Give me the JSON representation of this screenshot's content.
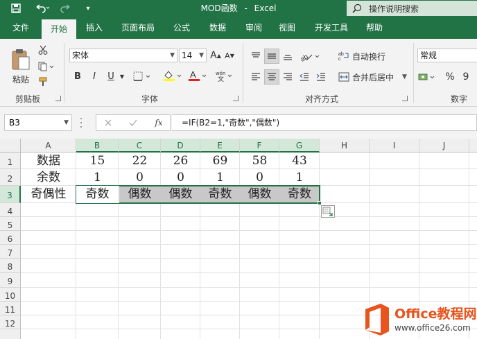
{
  "titlebar": {
    "doc_name": "MOD函数",
    "separator": "-",
    "app_name": "Excel",
    "tell_me": "操作说明搜索"
  },
  "tabs": [
    "文件",
    "开始",
    "插入",
    "页面布局",
    "公式",
    "数据",
    "审阅",
    "视图",
    "开发工具",
    "帮助"
  ],
  "ribbon": {
    "clipboard": {
      "paste": "粘贴",
      "label": "剪贴板"
    },
    "font": {
      "name": "宋体",
      "size": "14",
      "bold": "B",
      "italic": "I",
      "underline": "U",
      "label": "字体",
      "grow": "A",
      "shrink": "A"
    },
    "alignment": {
      "wrap": "自动换行",
      "merge": "合并后居中",
      "label": "对齐方式"
    },
    "number": {
      "format": "常规",
      "percent": "%",
      "comma": "9",
      "label": "数字"
    }
  },
  "formula_bar": {
    "name_box": "B3",
    "fx": "fx",
    "formula": "=IF(B2=1,\"奇数\",\"偶数\")"
  },
  "sheet": {
    "columns": [
      "A",
      "B",
      "C",
      "D",
      "E",
      "F",
      "G",
      "H",
      "I",
      "J"
    ],
    "rows": [
      "1",
      "2",
      "3",
      "4",
      "5",
      "6",
      "7",
      "8",
      "9",
      "10",
      "11",
      "12"
    ],
    "cells": [
      [
        "数据",
        "15",
        "22",
        "26",
        "69",
        "58",
        "43"
      ],
      [
        "余数",
        "1",
        "0",
        "0",
        "1",
        "0",
        "1"
      ],
      [
        "奇偶性",
        "奇数",
        "偶数",
        "偶数",
        "奇数",
        "偶数",
        "奇数"
      ]
    ]
  },
  "watermark": {
    "brand": "Office教程网",
    "url": "www.office26.com"
  },
  "colors": {
    "excel_green": "#217346",
    "ribbon_bg": "#f3f3f3",
    "selected_fill": "#c8c8c8",
    "logo_orange": "#e8541e"
  }
}
